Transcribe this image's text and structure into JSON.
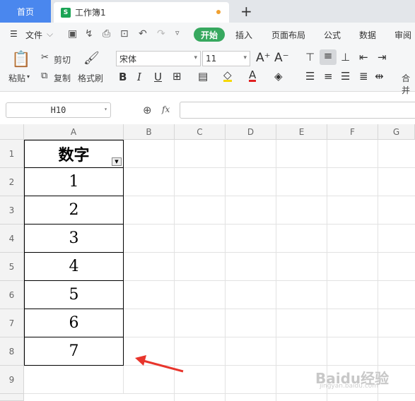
{
  "tabs": {
    "home": "首页",
    "doc": "工作簿1",
    "doc_icon": "S"
  },
  "menu": {
    "file": "文件",
    "start": "开始",
    "items": [
      "插入",
      "页面布局",
      "公式",
      "数据",
      "审阅"
    ]
  },
  "ribbon": {
    "paste": "粘贴",
    "cut": "剪切",
    "copy": "复制",
    "format_painter": "格式刷",
    "font_name": "宋体",
    "font_size": "11",
    "merge": "合并"
  },
  "formula_bar": {
    "name_box": "H10",
    "fx": "fx",
    "value": ""
  },
  "columns": [
    "A",
    "B",
    "C",
    "D",
    "E",
    "F",
    "G"
  ],
  "rows": [
    "1",
    "2",
    "3",
    "4",
    "5",
    "6",
    "7",
    "8",
    "9"
  ],
  "cells_a": [
    "数字",
    "1",
    "2",
    "3",
    "4",
    "5",
    "6",
    "7"
  ],
  "watermark": {
    "main": "Baidu经验",
    "sub": "jingyan.baidu.com"
  },
  "colors": {
    "accent_green": "#37a85f",
    "tab_blue": "#4a87ee",
    "arrow_red": "#e8352c"
  }
}
